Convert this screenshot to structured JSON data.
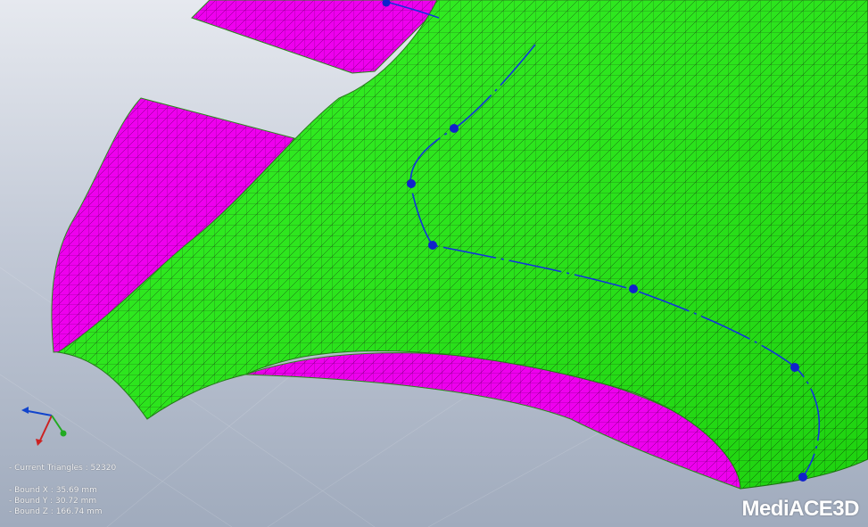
{
  "viewport": {
    "stats": {
      "current_triangles": "- Current Triangles : 52320",
      "bound_x": "- Bound X : 35.69 mm",
      "bound_y": "- Bound Y : 30.72 mm",
      "bound_z": "- Bound Z : 166.74 mm"
    },
    "logo": "MediACE3D",
    "colors": {
      "mesh_outer": "#22ee11",
      "mesh_inner": "#ee00ee",
      "curve": "#1133dd",
      "axis_x": "#cc2222",
      "axis_y": "#1144cc",
      "axis_z": "#22aa22"
    },
    "icons": [
      "axis-triad-icon"
    ]
  }
}
